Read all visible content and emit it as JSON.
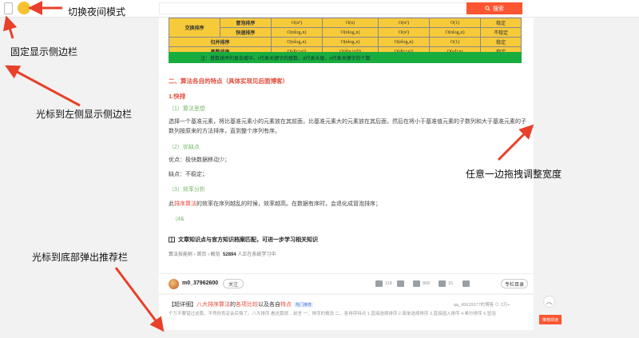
{
  "topbar": {
    "search_placeholder": "",
    "search_button_label": "搜索"
  },
  "table": {
    "rows": [
      [
        "交换排序",
        "冒泡排序",
        "O(n²)",
        "O(n)",
        "O(n²)",
        "O(1)",
        "稳定"
      ],
      [
        "",
        "快速排序",
        "O(nlog₂n)",
        "O(nlog₂n)",
        "O(n²)",
        "O(nlog₂n)",
        "不稳定"
      ],
      [
        "归并排序",
        "",
        "O(nlog₂n)",
        "O(nlog₂n)",
        "O(nlog₂n)",
        "O(1)",
        "稳定"
      ],
      [
        "基数排序",
        "",
        "O(d(r+n))",
        "O(d(n+rd))",
        "O(d(r+n))",
        "O(rd+n)",
        "稳定"
      ]
    ],
    "note": "注：基数排序的复杂度中，r代表关键字的基数，d代表长度，n代表关键字的个数"
  },
  "article": {
    "section_title": "二、算法各自的特点（具体实现见后面博客）",
    "sub_title": "1.快排",
    "idea_label": "（1）算法思想",
    "idea_text": "选择一个基准元素，将比基准元素小的元素放在其前面，比基准元素大的元素放在其后面，然后在将小于基准值元素的子数列和大于基准元素的子数列按原来的方法排序，直到整个序列有序。",
    "pros_cons_label": "（2）优缺点",
    "pros": "优点：极快数据移动少；",
    "cons": "缺点：不稳定；",
    "efficiency_label": "（3）效率分析",
    "efficiency_prefix": "此",
    "efficiency_link": "排序算法",
    "efficiency_text": "的效率在序列越乱的时候，效率越高。在数据有序时，会退化成冒泡排序；",
    "item_4": "（4&",
    "knowledge_text": "文章知识点与官方知识档案匹配，可进一步学习相关知识",
    "crumbs": "算法技能树 › 首页 › 概览",
    "crumbs_count": "52894",
    "crumbs_suffix": "人正在系统学习中"
  },
  "author": {
    "name": "m0_37962600",
    "follow_label": "关注",
    "likes": "118",
    "favorites": "808",
    "comments": "15",
    "toc_label": "专栏目录"
  },
  "recommend": {
    "prefix": "【超详细】",
    "title_link": "八大排序算法",
    "mid1": "的",
    "title_link2": "各项比较",
    "mid2": "以及各自",
    "title_link3": "特点",
    "tag": "热门推荐",
    "meta": "qq_45615577的博客  ⊙ 2万+",
    "desc": "千万不要错过这篇，不然你肯定会后悔了。八大排序,看这篇就... 前言 一、排序的概念 二、各排序特点 1.直接选择排序 2.简单选择排序 3.直接插入排序 4.希尔排序 5.冒泡",
    "tab_label": "推荐阅读"
  },
  "annotations": {
    "night_mode": "切换夜间模式",
    "pin_sidebar": "固定显示侧边栏",
    "left_sidebar": "光标到左侧显示侧边栏",
    "drag_width": "任意一边拖拽调整宽度",
    "bottom_popup": "光标到底部弹出推荐栏"
  },
  "colors": {
    "accent": "#fc5531",
    "annotation_arrow": "#e8402a",
    "table_fill": "#f7ca3a",
    "note_fill": "#19ad3f"
  }
}
